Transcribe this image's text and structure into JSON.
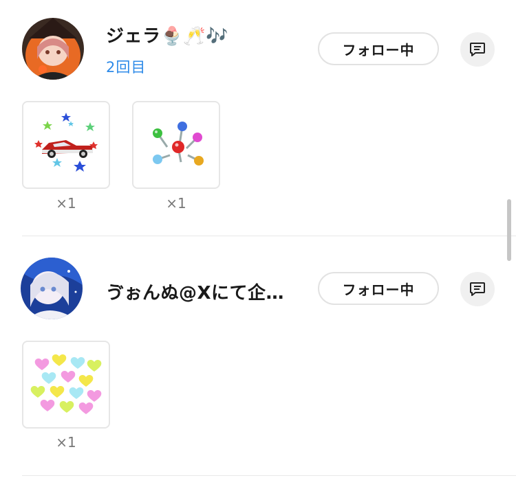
{
  "entries": [
    {
      "username": "ジェラ🍨🥂🎶",
      "count_label": "2回目",
      "follow_label": "フォロー中",
      "gifts": [
        {
          "icon": "car-stars-gift",
          "count": "×1"
        },
        {
          "icon": "lollipops-gift",
          "count": "×1"
        }
      ]
    },
    {
      "username": "ゔぉんぬ@Xにて企…",
      "follow_label": "フォロー中",
      "gifts": [
        {
          "icon": "hearts-gift",
          "count": "×1"
        }
      ]
    }
  ],
  "colors": {
    "accent": "#2d8ae8",
    "border": "#e2e2e2",
    "muted": "#777777"
  }
}
